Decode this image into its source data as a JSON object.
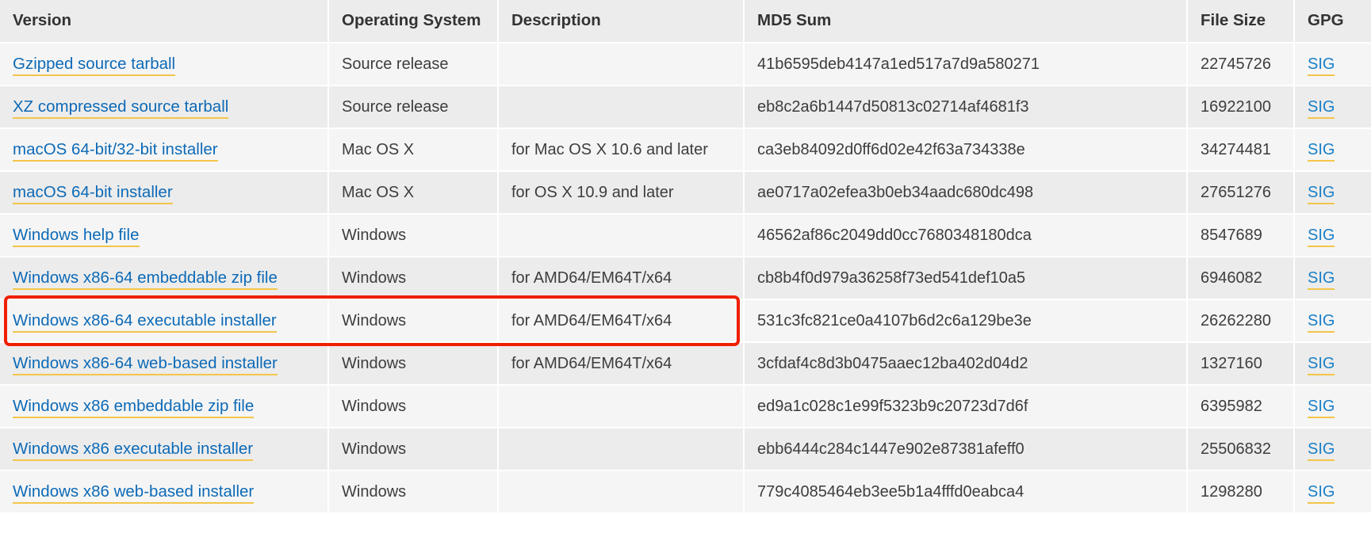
{
  "table": {
    "columns": [
      "Version",
      "Operating System",
      "Description",
      "MD5 Sum",
      "File Size",
      "GPG"
    ],
    "rows": [
      {
        "version": "Gzipped source tarball",
        "os": "Source release",
        "description": "",
        "md5": "41b6595deb4147a1ed517a7d9a580271",
        "size": "22745726",
        "gpg": "SIG"
      },
      {
        "version": "XZ compressed source tarball",
        "os": "Source release",
        "description": "",
        "md5": "eb8c2a6b1447d50813c02714af4681f3",
        "size": "16922100",
        "gpg": "SIG"
      },
      {
        "version": "macOS 64-bit/32-bit installer",
        "os": "Mac OS X",
        "description": "for Mac OS X 10.6 and later",
        "md5": "ca3eb84092d0ff6d02e42f63a734338e",
        "size": "34274481",
        "gpg": "SIG"
      },
      {
        "version": "macOS 64-bit installer",
        "os": "Mac OS X",
        "description": "for OS X 10.9 and later",
        "md5": "ae0717a02efea3b0eb34aadc680dc498",
        "size": "27651276",
        "gpg": "SIG"
      },
      {
        "version": "Windows help file",
        "os": "Windows",
        "description": "",
        "md5": "46562af86c2049dd0cc7680348180dca",
        "size": "8547689",
        "gpg": "SIG"
      },
      {
        "version": "Windows x86-64 embeddable zip file",
        "os": "Windows",
        "description": "for AMD64/EM64T/x64",
        "md5": "cb8b4f0d979a36258f73ed541def10a5",
        "size": "6946082",
        "gpg": "SIG"
      },
      {
        "version": "Windows x86-64 executable installer",
        "os": "Windows",
        "description": "for AMD64/EM64T/x64",
        "md5": "531c3fc821ce0a4107b6d2c6a129be3e",
        "size": "26262280",
        "gpg": "SIG"
      },
      {
        "version": "Windows x86-64 web-based installer",
        "os": "Windows",
        "description": "for AMD64/EM64T/x64",
        "md5": "3cfdaf4c8d3b0475aaec12ba402d04d2",
        "size": "1327160",
        "gpg": "SIG"
      },
      {
        "version": "Windows x86 embeddable zip file",
        "os": "Windows",
        "description": "",
        "md5": "ed9a1c028c1e99f5323b9c20723d7d6f",
        "size": "6395982",
        "gpg": "SIG"
      },
      {
        "version": "Windows x86 executable installer",
        "os": "Windows",
        "description": "",
        "md5": "ebb6444c284c1447e902e87381afeff0",
        "size": "25506832",
        "gpg": "SIG"
      },
      {
        "version": "Windows x86 web-based installer",
        "os": "Windows",
        "description": "",
        "md5": "779c4085464eb3ee5b1a4fffd0eabca4",
        "size": "1298280",
        "gpg": "SIG"
      }
    ]
  },
  "annotation": {
    "highlight_color": "#f01f00",
    "highlight_target_row_index": 6
  },
  "colors": {
    "link": "#0d6ab7",
    "link_underline": "#f3c54a",
    "header_bg": "#ececec",
    "row_odd_bg": "#f5f5f5",
    "row_even_bg": "#ececec",
    "text": "#333333"
  }
}
